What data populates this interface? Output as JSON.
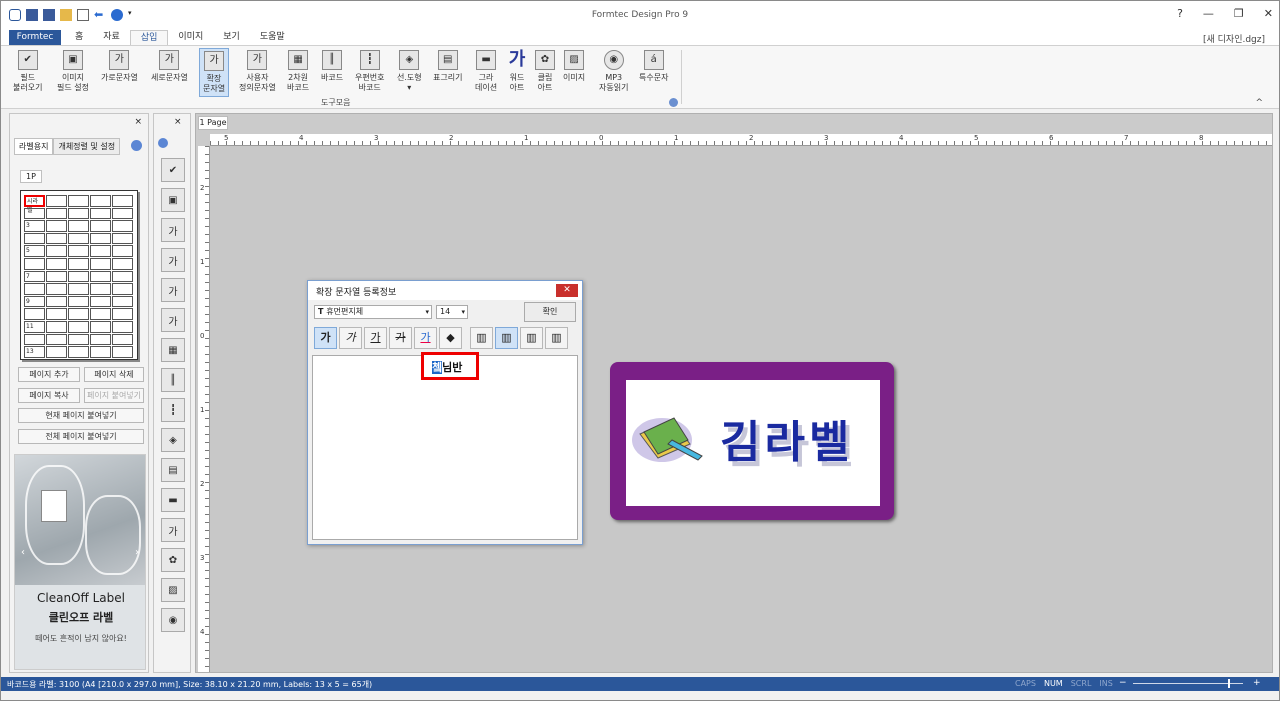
{
  "app": {
    "title": "Formtec Design Pro 9",
    "document": "[새 디자인.dgz]"
  },
  "window_controls": [
    "?",
    "—",
    "❐",
    "✕"
  ],
  "file_tab": "Formtec",
  "tabs": [
    "홈",
    "자료",
    "삽입",
    "이미지",
    "보기",
    "도움말"
  ],
  "active_tab": "삽입",
  "ribbon": {
    "buttons": [
      {
        "label1": "필드",
        "label2": "불러오기",
        "icon": "✔"
      },
      {
        "label1": "이미지",
        "label2": "필드 설정",
        "icon": "▣"
      },
      {
        "label1": "가로문자열",
        "label2": "",
        "icon": "가"
      },
      {
        "label1": "세로문자열",
        "label2": "",
        "icon": "가"
      },
      {
        "label1": "확장",
        "label2": "문자열",
        "icon": "가"
      },
      {
        "label1": "사용자",
        "label2": "정의문자열",
        "icon": "가"
      },
      {
        "label1": "2차원",
        "label2": "바코드",
        "icon": "▦"
      },
      {
        "label1": "바코드",
        "label2": "",
        "icon": "║"
      },
      {
        "label1": "우편번호",
        "label2": "바코드",
        "icon": "┇"
      },
      {
        "label1": "선.도형",
        "label2": "▾",
        "icon": "◈"
      },
      {
        "label1": "표그리기",
        "label2": "",
        "icon": "▤"
      },
      {
        "label1": "그라",
        "label2": "데이션",
        "icon": "▬"
      },
      {
        "label1": "워드",
        "label2": "아트",
        "icon": "가"
      },
      {
        "label1": "클립",
        "label2": "아트",
        "icon": "✿"
      },
      {
        "label1": "이미지",
        "label2": "",
        "icon": "▨"
      },
      {
        "label1": "MP3",
        "label2": "자동읽기",
        "icon": "◉"
      },
      {
        "label1": "특수문자",
        "label2": "",
        "icon": "á"
      }
    ],
    "group_label": "도구모음",
    "collapse": "^"
  },
  "left_panel": {
    "close": "×",
    "tabs": [
      "라벨용지",
      "개체정렬 및 설정"
    ],
    "page_tab": "1P",
    "row_numbers": [
      "",
      "",
      "3",
      "",
      "5",
      "",
      "7",
      "",
      "9",
      "",
      "11",
      "",
      "13"
    ],
    "first_cell": "시라벨",
    "buttons": {
      "add_page": "페이지 추가",
      "delete_page": "페이지 삭제",
      "copy_page": "페이지 복사",
      "paste_page": "페이지 붙여넣기",
      "paste_current": "현재 페이지 붙여넣기",
      "paste_all": "전체 페이지 붙여넣기"
    },
    "ad": {
      "brand": "CleanOff Label",
      "brand_ko": "클린오프 라벨",
      "tagline": "떼어도 흔적이 남지 않아요!",
      "prev": "‹",
      "next": "›"
    }
  },
  "toolbox": {
    "close": "×",
    "icons": [
      "✔",
      "▣",
      "가",
      "가",
      "가",
      "가",
      "▦",
      "║",
      "┇",
      "◈",
      "▤",
      "▬",
      "가",
      "✿",
      "▨",
      "◉"
    ]
  },
  "document": {
    "tab": "1 Page",
    "ruler_h": [
      "5",
      "4",
      "3",
      "2",
      "1",
      "0",
      "1",
      "2",
      "3",
      "4",
      "5",
      "6",
      "7",
      "8"
    ],
    "ruler_v": [
      "2",
      "1",
      "0",
      "1",
      "2",
      "3",
      "4"
    ]
  },
  "label_preview": {
    "text": "김라벨"
  },
  "dialog": {
    "title": "확장 문자열 등록정보",
    "close": "✕",
    "font": "휴먼편지체",
    "size": "14",
    "ok": "확인",
    "format_buttons": [
      "가",
      "가",
      "가",
      "가",
      "가",
      "◆",
      "▥",
      "▥",
      "▥",
      "▥"
    ],
    "field_text_cursor": "쳌",
    "field_text": "님반"
  },
  "status": {
    "text": "바코드용 라벨: 3100 (A4 [210.0 x 297.0 mm], Size: 38.10 x 21.20 mm, Labels: 13 x 5 = 65개)",
    "flags": [
      "CAPS",
      "NUM",
      "SCRL",
      "INS"
    ],
    "active_flags": [
      "NUM"
    ],
    "zoom_minus": "−",
    "zoom_plus": "+",
    "zoom_level": 0.86
  }
}
